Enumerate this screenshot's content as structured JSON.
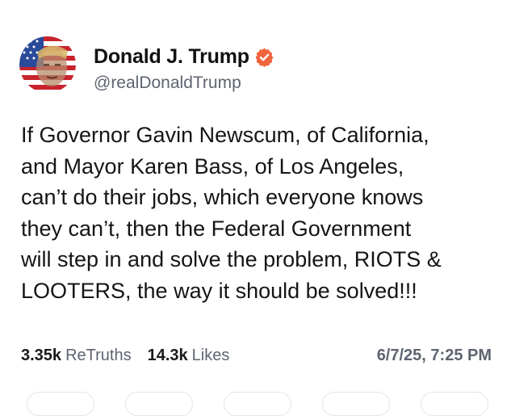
{
  "author": {
    "name": "Donald J. Trump",
    "handle": "@realDonaldTrump",
    "verified": true,
    "verified_color": "#f0643c",
    "avatar_icon": "flag-portrait-avatar"
  },
  "post": {
    "text": "If Governor Gavin Newscum, of California,\nand Mayor Karen Bass, of Los Angeles,\ncan’t do their jobs, which everyone knows\nthey can’t, then the Federal Government\nwill step in and solve the problem, RIOTS &\nLOOTERS, the way it should be solved!!!"
  },
  "stats": {
    "retruths_count": "3.35k",
    "retruths_label": "ReTruths",
    "likes_count": "14.3k",
    "likes_label": "Likes",
    "timestamp": "6/7/25, 7:25 PM"
  },
  "actions": {
    "icons": [
      "reply-icon",
      "retruth-icon",
      "like-icon",
      "share-icon",
      "more-icon"
    ]
  }
}
